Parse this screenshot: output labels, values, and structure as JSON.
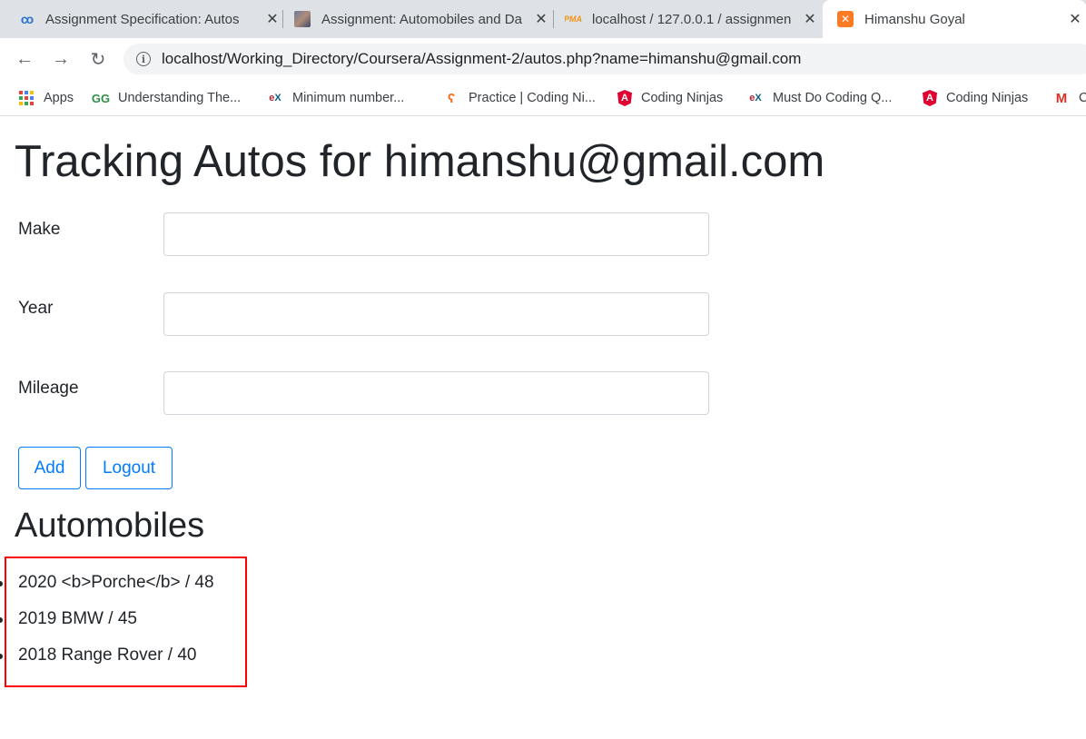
{
  "browser": {
    "tabs": [
      {
        "title": "Assignment Specification: Autos",
        "icon": "coursera-icon"
      },
      {
        "title": "Assignment: Automobiles and Da",
        "icon": "profile-image-icon"
      },
      {
        "title": "localhost / 127.0.0.1 / assignmen",
        "icon": "phpmyadmin-icon"
      },
      {
        "title": "Himanshu Goyal",
        "icon": "xampp-icon",
        "active": true
      }
    ],
    "url": "localhost/Working_Directory/Coursera/Assignment-2/autos.php?name=himanshu@gmail.com",
    "bookmarks": [
      {
        "label": "Apps",
        "icon": "apps-grid-icon"
      },
      {
        "label": "Understanding The...",
        "icon": "geeksforgeeks-icon"
      },
      {
        "label": "Minimum number...",
        "icon": "edx-icon"
      },
      {
        "label": "Practice | Coding Ni...",
        "icon": "coding-ninjas-icon"
      },
      {
        "label": "Coding Ninjas",
        "icon": "angular-icon"
      },
      {
        "label": "Must Do Coding Q...",
        "icon": "edx-icon"
      },
      {
        "label": "Coding Ninjas",
        "icon": "angular-icon"
      },
      {
        "label": "C",
        "icon": "gmail-icon"
      }
    ]
  },
  "page": {
    "title": "Tracking Autos for himanshu@gmail.com",
    "form": {
      "make_label": "Make",
      "year_label": "Year",
      "mileage_label": "Mileage",
      "make_value": "",
      "year_value": "",
      "mileage_value": "",
      "add_label": "Add",
      "logout_label": "Logout"
    },
    "section_title": "Automobiles",
    "automobiles": [
      "2020 <b>Porche</b> / 48",
      "2019 BMW / 45",
      "2018 Range Rover / 40"
    ],
    "highlight_color": "#ff0000",
    "accent_color": "#007bff"
  }
}
